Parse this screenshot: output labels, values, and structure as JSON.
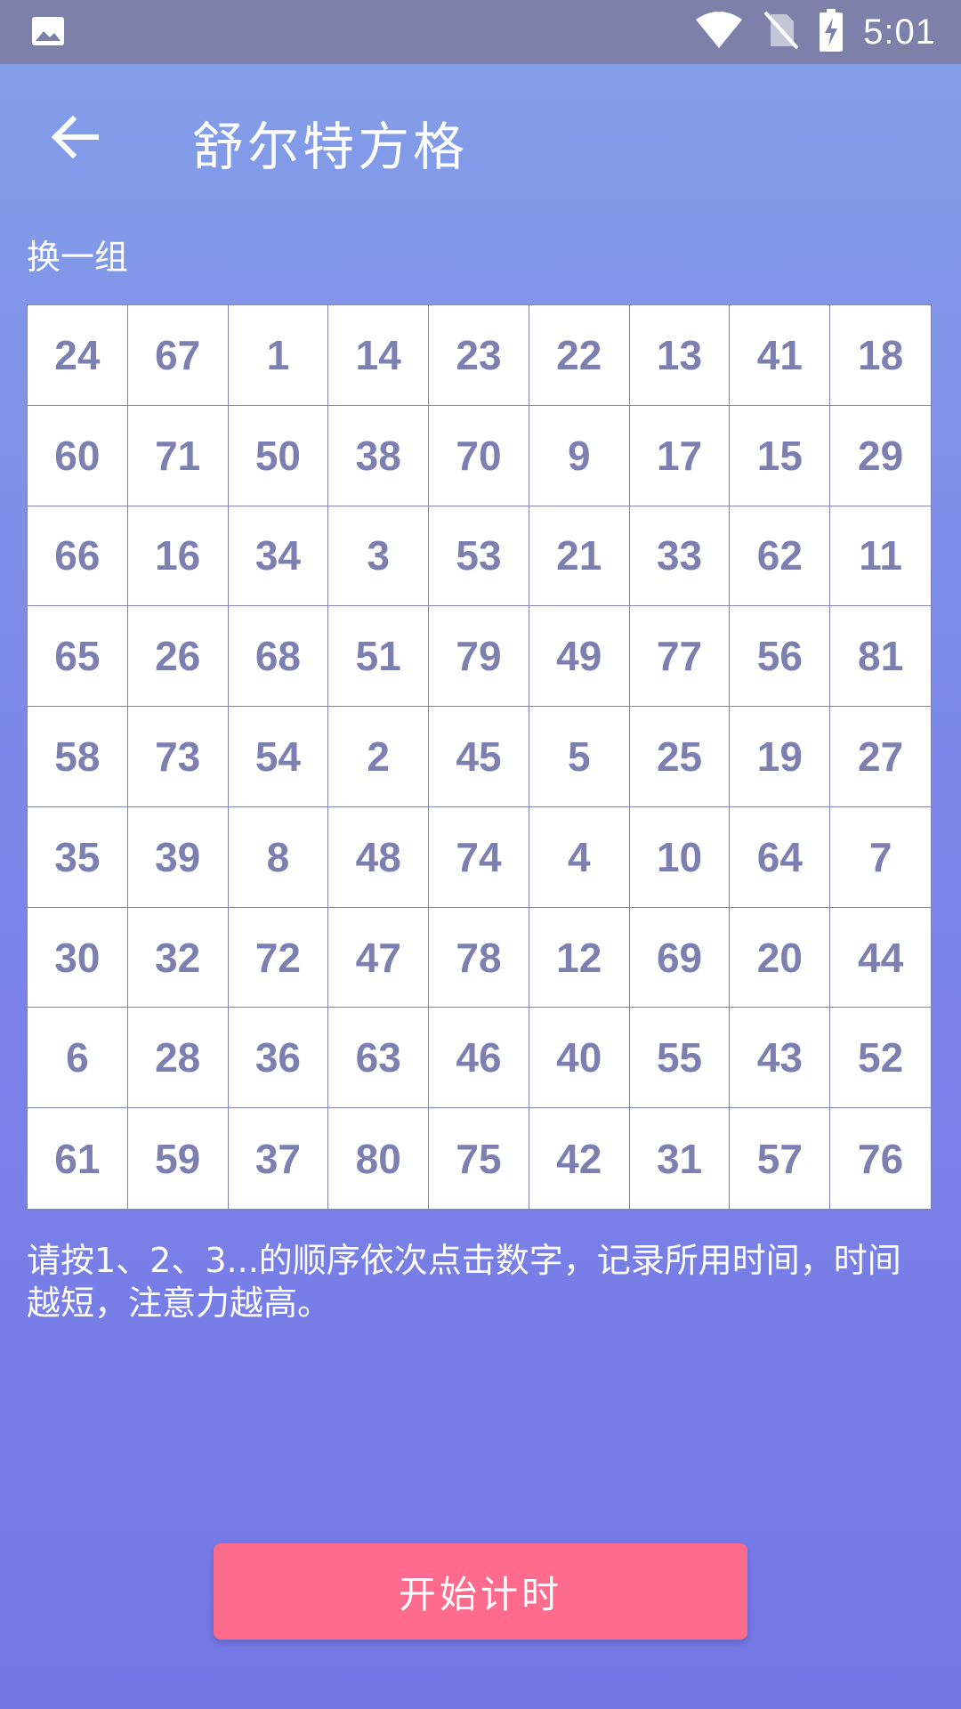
{
  "status_bar": {
    "time": "5:01",
    "icons": [
      "image-icon",
      "wifi-icon",
      "no-sim-icon",
      "battery-charging-icon"
    ]
  },
  "app_bar": {
    "back_icon": "arrow-left-icon",
    "title": "舒尔特方格"
  },
  "shuffle_label": "换一组",
  "grid": {
    "rows": [
      [
        "24",
        "67",
        "1",
        "14",
        "23",
        "22",
        "13",
        "41",
        "18"
      ],
      [
        "60",
        "71",
        "50",
        "38",
        "70",
        "9",
        "17",
        "15",
        "29"
      ],
      [
        "66",
        "16",
        "34",
        "3",
        "53",
        "21",
        "33",
        "62",
        "11"
      ],
      [
        "65",
        "26",
        "68",
        "51",
        "79",
        "49",
        "77",
        "56",
        "81"
      ],
      [
        "58",
        "73",
        "54",
        "2",
        "45",
        "5",
        "25",
        "19",
        "27"
      ],
      [
        "35",
        "39",
        "8",
        "48",
        "74",
        "4",
        "10",
        "64",
        "7"
      ],
      [
        "30",
        "32",
        "72",
        "47",
        "78",
        "12",
        "69",
        "20",
        "44"
      ],
      [
        "6",
        "28",
        "36",
        "63",
        "46",
        "40",
        "55",
        "43",
        "52"
      ],
      [
        "61",
        "59",
        "37",
        "80",
        "75",
        "42",
        "31",
        "57",
        "76"
      ]
    ]
  },
  "instructions": "请按1、2、3...的顺序依次点击数字，记录所用时间，时间越短，注意力越高。",
  "start_button": "开始计时",
  "colors": {
    "status_bar": "#7D80A9",
    "gradient_top": "#84A0E8",
    "gradient_bottom": "#7478E6",
    "cell_text": "#7C7FAF",
    "grid_line": "#8083B3",
    "button": "#FF6B8D"
  }
}
